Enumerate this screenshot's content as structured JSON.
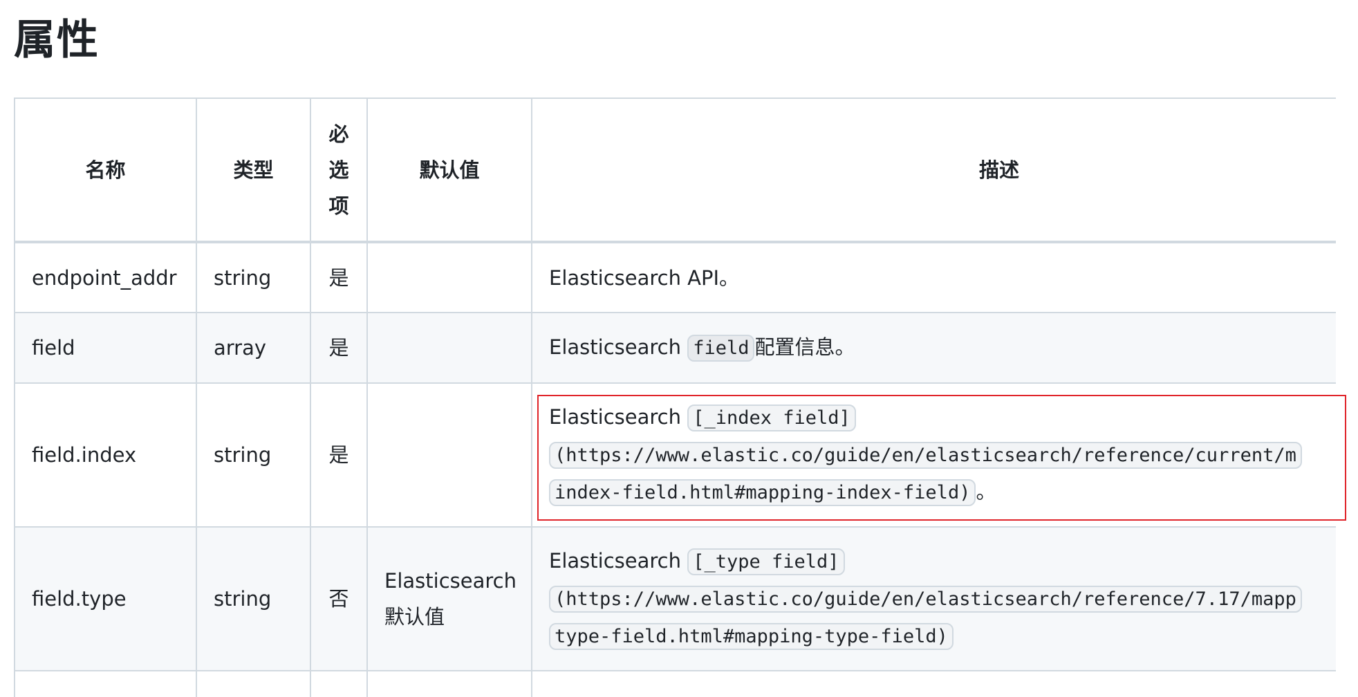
{
  "page": {
    "heading": "属性"
  },
  "table": {
    "headers": {
      "name": "名称",
      "type": "类型",
      "required": [
        "必",
        "选",
        "项"
      ],
      "default": "默认值",
      "description": "描述"
    },
    "rows": [
      {
        "name": "endpoint_addr",
        "type": "string",
        "required": "是",
        "default": "",
        "description": {
          "prefix": "Elasticsearch API。"
        }
      },
      {
        "name": "field",
        "type": "array",
        "required": "是",
        "default": "",
        "description": {
          "prefix": "Elasticsearch ",
          "code": "field",
          "suffix": "配置信息。"
        }
      },
      {
        "name": "field.index",
        "type": "string",
        "required": "是",
        "default": "",
        "description": {
          "prefix": "Elasticsearch ",
          "code1": "[_index field]",
          "code2": "(https://www.elastic.co/guide/en/elasticsearch/reference/current/m",
          "code3": "index-field.html#mapping-index-field)",
          "suffix": "。"
        }
      },
      {
        "name": "field.type",
        "type": "string",
        "required": "否",
        "default_line1": "Elasticsearch",
        "default_line2": "默认值",
        "description": {
          "prefix": "Elasticsearch ",
          "code1": "[_type field]",
          "code2": "(https://www.elastic.co/guide/en/elasticsearch/reference/7.17/mapp",
          "code3": "type-field.html#mapping-type-field)"
        }
      }
    ]
  },
  "colors": {
    "border": "#d1d9e0",
    "stripe": "#f6f8fa",
    "highlight": "#e0242a"
  }
}
